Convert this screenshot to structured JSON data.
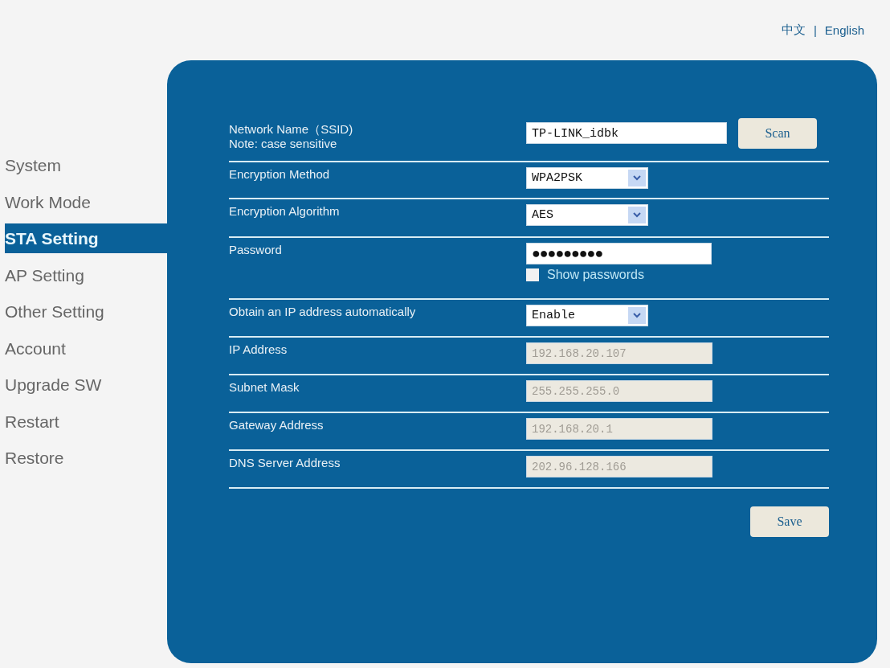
{
  "language_links": [
    {
      "label": "中文"
    },
    {
      "label": "English"
    }
  ],
  "language_separator": "|",
  "sidebar": {
    "items": [
      {
        "label": "System",
        "selected": false
      },
      {
        "label": "Work Mode",
        "selected": false
      },
      {
        "label": "STA Setting",
        "selected": true
      },
      {
        "label": "AP Setting",
        "selected": false
      },
      {
        "label": "Other Setting",
        "selected": false
      },
      {
        "label": "Account",
        "selected": false
      },
      {
        "label": "Upgrade SW",
        "selected": false
      },
      {
        "label": "Restart",
        "selected": false
      },
      {
        "label": "Restore",
        "selected": false
      }
    ]
  },
  "form": {
    "rows": [
      {
        "kind": "text",
        "label": "Network Name（SSID)",
        "note": "Note: case sensitive",
        "value": "TP-LINK_idbk",
        "button": "Scan"
      },
      {
        "kind": "select",
        "label": "Encryption Method",
        "value": "WPA2PSK"
      },
      {
        "kind": "select",
        "label": "Encryption Algorithm",
        "value": "AES"
      },
      {
        "kind": "password",
        "label": "Password",
        "value": "●●●●●●●●●",
        "checkbox": {
          "label": "Show passwords",
          "checked": false
        }
      },
      {
        "kind": "select",
        "label": "Obtain an IP address automatically",
        "value": "Enable"
      },
      {
        "kind": "readonly",
        "label": "IP Address",
        "value": "192.168.20.107"
      },
      {
        "kind": "readonly",
        "label": "Subnet Mask",
        "value": "255.255.255.0"
      },
      {
        "kind": "readonly",
        "label": "Gateway Address",
        "value": "192.168.20.1"
      },
      {
        "kind": "readonly",
        "label": "DNS Server Address",
        "value": "202.96.128.166"
      }
    ],
    "save_button": "Save"
  }
}
